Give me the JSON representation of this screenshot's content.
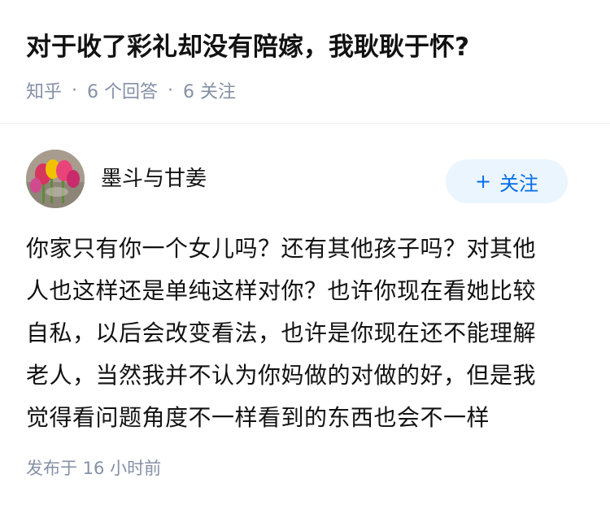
{
  "question": {
    "title": "对于收了彩礼却没有陪嫁，我耿耿于怀?",
    "source": "知乎",
    "separator": "·",
    "answer_count": "6 个回答",
    "follower_count": "6 关注"
  },
  "author": {
    "name": "墨斗与甘姜",
    "follow_label": "关注",
    "follow_icon": "+",
    "avatar_icon": "tulip-photo-avatar"
  },
  "answer": {
    "lines": [
      "你家只有你一个女儿吗？还有其他孩子吗？对其他",
      "人也这样还是单纯这样对你？也许你现在看她比较",
      "自私，以后会改变看法，也许是你现在还不能理解",
      "老人，当然我并不认为你妈做的对做的好，但是我",
      "觉得看问题角度不一样看到的东西也会不一样"
    ]
  },
  "footer": {
    "published": "发布于  16 小时前"
  },
  "colors": {
    "text": "#121212",
    "meta": "#8590a6",
    "accent": "#056de8",
    "follow_bg": "#ebf5fd",
    "divider": "#ebebeb"
  }
}
